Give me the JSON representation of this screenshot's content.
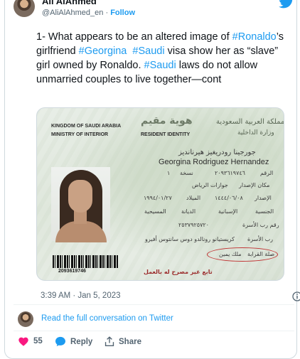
{
  "header": {
    "name": "Ali AlAhmed",
    "handle": "@AliAlAhmed_en",
    "separator": "·",
    "follow_label": "Follow"
  },
  "tweet": {
    "t1": "1- What appears to be an altered image of ",
    "tag1": "#Ronaldo",
    "t2": "’s girlfriend ",
    "tag2": "#Georgina",
    "t3": "  ",
    "tag3": "#Saudi",
    "t4": " visa show her as “slave” girl owned by Ronaldo. ",
    "tag4": "#Saudi",
    "t5": " laws do not allow unmarried couples to live together—cont"
  },
  "id_card": {
    "kingdom": "KINGDOM OF SAUDI ARABIA",
    "ministry": "MINISTRY OF INTERIOR",
    "resident_identity": "RESIDENT IDENTITY",
    "ar_title": "هوية مقيم",
    "ar_kingdom": "المملكة العربية السعودية",
    "ar_ministry": "وزارة الداخلية",
    "ar_name": "جورجينا رودريغيز هيرنانديز",
    "name_en": "Georgina Rodriguez Hernandez",
    "ar_number_label": "الرقم",
    "ar_number": "٢٠٩٣٦١٩٧٤٦",
    "ar_copy_label": "نسخة",
    "ar_copy": "١",
    "ar_issue_place_label": "مكان الإصدار",
    "ar_issue_place": "جوازات الرياض",
    "ar_issue_label": "الإصدار",
    "ar_issue_date": "١٤٤٤/٠٦/٠٨",
    "ar_birth_label": "الميلاد",
    "ar_birth_date": "١٩٩٤/٠١/٢٧",
    "ar_nationality_label": "الجنسية",
    "ar_nationality": "الإسبانية",
    "ar_religion_label": "الديانة",
    "ar_religion": "المسيحية",
    "ar_family_label": "رقم رب الأسرة",
    "ar_family_number": "٢٥٣٧٩٢٥٧٢٠",
    "ar_head_label": "رب الأسرة",
    "ar_head_name": "كريستيانو رونالدو دوس سانتوس أفيرو",
    "ar_relation_label": "صلة القرابة",
    "ar_relation": "ملك يمين",
    "ar_work_note": "تابع غير مصرح له بالعمل",
    "barcode_number": "2093619746"
  },
  "footer": {
    "timestamp": "3:39 AM · Jan 5, 2023",
    "conversation_link": "Read the full conversation on Twitter",
    "likes": "55",
    "reply_label": "Reply",
    "share_label": "Share"
  },
  "colors": {
    "accent": "#1d9bf0",
    "like": "#f91880",
    "muted": "#536471",
    "text": "#0f1419"
  }
}
